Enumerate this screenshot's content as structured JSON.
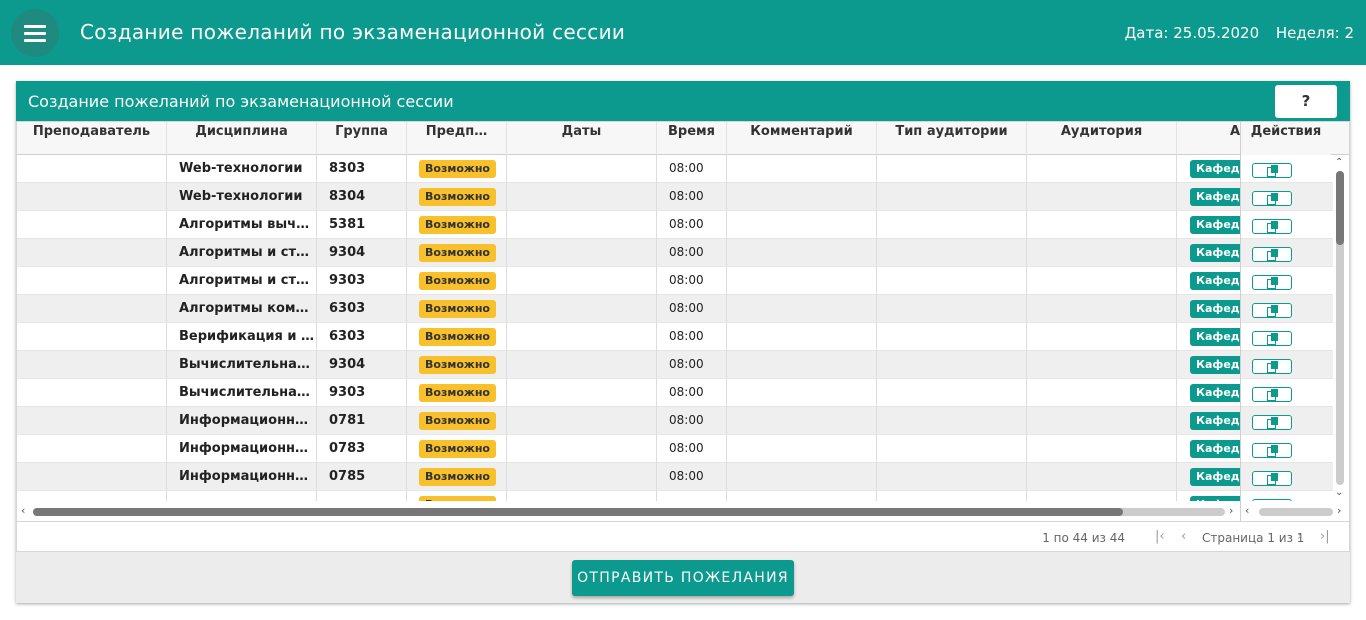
{
  "appbar": {
    "title": "Создание пожеланий по экзаменационной сессии",
    "date": "Дата: 25.05.2020",
    "week": "Неделя: 2"
  },
  "panel": {
    "title": "Создание пожеланий по экзаменационной сессии",
    "help_label": "?"
  },
  "columns": {
    "teacher": "Преподаватель",
    "discipline": "Дисциплина",
    "group": "Группа",
    "pref": "Предп…",
    "dates": "Даты",
    "time": "Время",
    "comment": "Комментарий",
    "room_type": "Тип аудитории",
    "room": "Аудитория",
    "extra": "А",
    "actions": "Действия"
  },
  "rows": [
    {
      "teacher": "",
      "discipline": "Web-технологии",
      "group": "8303",
      "pref": "Возможно",
      "time": "08:00",
      "tag": "Кафедра"
    },
    {
      "teacher": "",
      "discipline": "Web-технологии",
      "group": "8304",
      "pref": "Возможно",
      "time": "08:00",
      "tag": "Кафедра"
    },
    {
      "teacher": "",
      "discipline": "Алгоритмы вычислительной геометрии",
      "group": "5381",
      "pref": "Возможно",
      "time": "08:00",
      "tag": "Кафедра"
    },
    {
      "teacher": "",
      "discipline": "Алгоритмы и структуры данных",
      "group": "9304",
      "pref": "Возможно",
      "time": "08:00",
      "tag": "Кафедра"
    },
    {
      "teacher": "",
      "discipline": "Алгоритмы и структуры данных",
      "group": "9303",
      "pref": "Возможно",
      "time": "08:00",
      "tag": "Кафедра"
    },
    {
      "teacher": "",
      "discipline": "Алгоритмы компьютерной графики",
      "group": "6303",
      "pref": "Возможно",
      "time": "08:00",
      "tag": "Кафедра"
    },
    {
      "teacher": "",
      "discipline": "Верификация и тестирование",
      "group": "6303",
      "pref": "Возможно",
      "time": "08:00",
      "tag": "Кафедра"
    },
    {
      "teacher": "",
      "discipline": "Вычислительная математика",
      "group": "9304",
      "pref": "Возможно",
      "time": "08:00",
      "tag": "Кафедра"
    },
    {
      "teacher": "",
      "discipline": "Вычислительная математика",
      "group": "9303",
      "pref": "Возможно",
      "time": "08:00",
      "tag": "Кафедра"
    },
    {
      "teacher": "",
      "discipline": "Информационные технологии",
      "group": "0781",
      "pref": "Возможно",
      "time": "08:00",
      "tag": "Кафедра"
    },
    {
      "teacher": "",
      "discipline": "Информационные технологии",
      "group": "0783",
      "pref": "Возможно",
      "time": "08:00",
      "tag": "Кафедра"
    },
    {
      "teacher": "",
      "discipline": "Информационные технологии",
      "group": "0785",
      "pref": "Возможно",
      "time": "08:00",
      "tag": "Кафедра"
    },
    {
      "teacher": "",
      "discipline": "",
      "group": "",
      "pref": "Возможно",
      "time": "",
      "tag": "Кафедра"
    }
  ],
  "paging": {
    "summary": "1 по 44 из 44",
    "page_text": "Страница 1 из 1"
  },
  "submit_label": "ОТПРАВИТЬ ПОЖЕЛАНИЯ",
  "colors": {
    "accent": "#0b9a8d",
    "badge_yellow": "#f8c02a"
  }
}
